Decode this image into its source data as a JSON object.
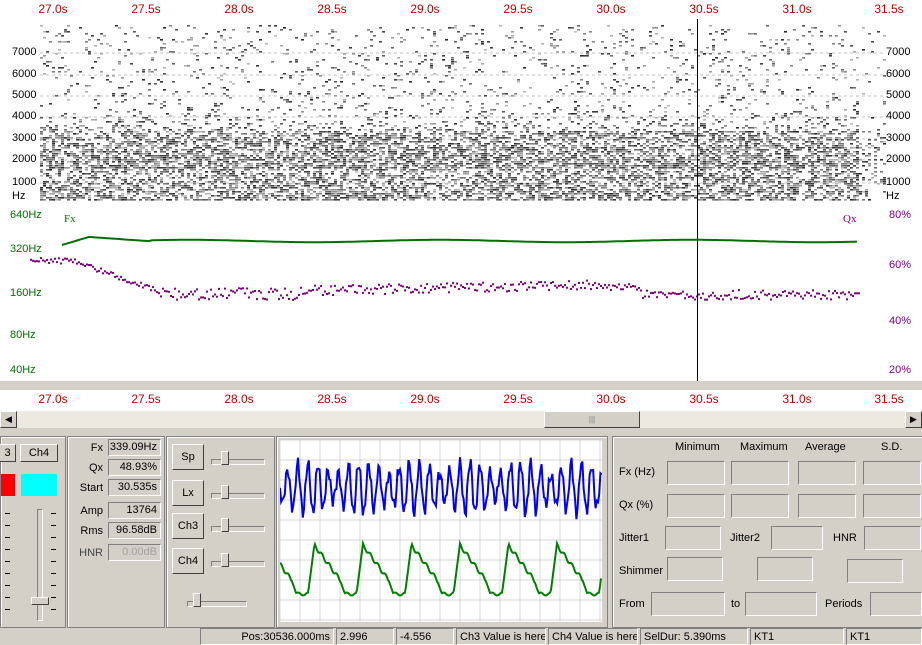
{
  "time_axis": {
    "labels": [
      "27.0s",
      "27.5s",
      "28.0s",
      "28.5s",
      "29.0s",
      "29.5s",
      "30.0s",
      "30.5s",
      "31.0s",
      "31.5s"
    ]
  },
  "spectrogram": {
    "y_labels": [
      "7000",
      "6000",
      "5000",
      "4000",
      "3000",
      "2000",
      "1000",
      "Hz"
    ]
  },
  "fx_panel": {
    "left_labels": [
      "640Hz",
      "320Hz",
      "160Hz",
      "80Hz",
      "40Hz"
    ],
    "right_labels": [
      "80%",
      "60%",
      "40%",
      "20%"
    ],
    "fx_name": "Fx",
    "qx_name": "Qx",
    "fx_color": "#007000",
    "qx_color": "#800080"
  },
  "channels": {
    "ch3_tab": "3",
    "ch4_tab": "Ch4",
    "ch3_color": "#ff0000",
    "ch4_color": "#00ffff"
  },
  "readouts": {
    "fx_label": "Fx",
    "fx_value": "339.09Hz",
    "qx_label": "Qx",
    "qx_value": "48.93%",
    "start_label": "Start",
    "start_value": "30.535s",
    "amp_label": "Amp",
    "amp_value": "13764",
    "rms_label": "Rms",
    "rms_value": "96.58dB",
    "hnr_label": "HNR",
    "hnr_value": "0.00dB"
  },
  "mini_buttons": {
    "sp": "Sp",
    "lx": "Lx",
    "ch3": "Ch3",
    "ch4": "Ch4"
  },
  "stats": {
    "col_min": "Minimum",
    "col_max": "Maximum",
    "col_avg": "Average",
    "col_sd": "S.D.",
    "fx_row": "Fx (Hz)",
    "qx_row": "Qx (%)",
    "jitter1": "Jitter1",
    "jitter2": "Jitter2",
    "hnr": "HNR",
    "shimmer": "Shimmer",
    "from": "From",
    "to": "to",
    "periods": "Periods"
  },
  "status_bar": {
    "pos": "Pos:30536.000ms",
    "v1": "2.996",
    "v2": "-4.556",
    "ch3": "Ch3 Value is here",
    "ch4": "Ch4 Value is here",
    "seldur": "SelDur: 5.390ms",
    "kt1a": "KT1",
    "kt1b": "KT1"
  }
}
